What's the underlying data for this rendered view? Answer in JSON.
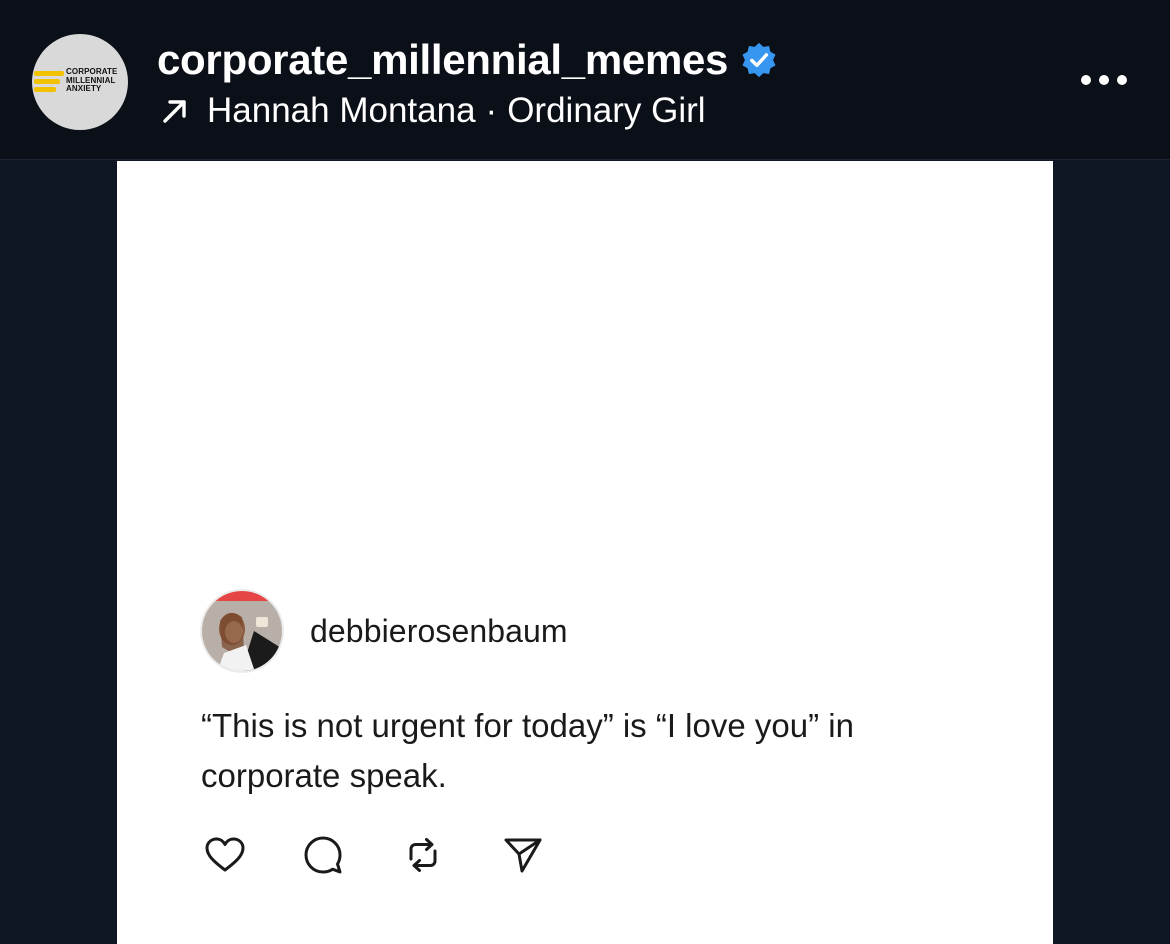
{
  "header": {
    "avatar_logo_text": [
      "CORPORATE",
      "MILLENNIAL",
      "ANXIETY"
    ],
    "username": "corporate_millennial_memes",
    "verified_icon": "verified-badge-icon",
    "music": {
      "icon": "arrow-up-right-icon",
      "artist": "Hannah Montana",
      "separator": "·",
      "title": "Ordinary Girl"
    },
    "more_icon": "more-horizontal-icon"
  },
  "post": {
    "author": "debbierosenbaum",
    "text": "“This is not urgent for today” is “I love you” in corporate speak.",
    "actions": [
      "heart-icon",
      "comment-icon",
      "repost-icon",
      "share-icon"
    ]
  },
  "colors": {
    "header_bg": "#0b0f17",
    "page_bg": "#0f1624",
    "card_bg": "#ffffff",
    "verified_blue": "#3797f0",
    "logo_yellow": "#f2c200"
  }
}
